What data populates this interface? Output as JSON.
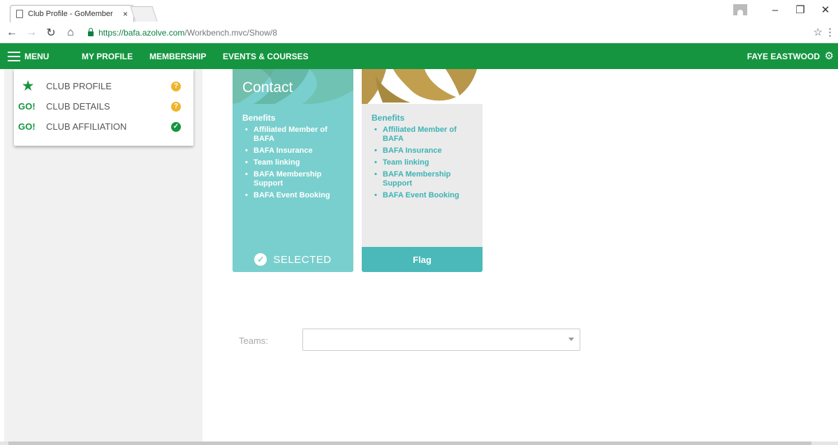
{
  "browser": {
    "tab_title": "Club Profile - GoMember",
    "tab_close": "×",
    "url_host": "https://bafa.azolve.com",
    "url_path": "/Workbench.mvc/Show/8",
    "window_minimize": "–",
    "window_restore": "❐",
    "window_close": "✕"
  },
  "header": {
    "menu_label": "MENU",
    "nav": [
      "MY PROFILE",
      "MEMBERSHIP",
      "EVENTS & COURSES"
    ],
    "user_name": "FAYE EASTWOOD",
    "accent_color": "#159540"
  },
  "steps": [
    {
      "icon": "star-icon",
      "label": "CLUB PROFILE",
      "status": "warning"
    },
    {
      "icon": "go-icon",
      "icon_text": "GO!",
      "label": "CLUB DETAILS",
      "status": "warning"
    },
    {
      "icon": "go-icon",
      "icon_text": "GO!",
      "label": "CLUB AFFILIATION",
      "status": "complete"
    }
  ],
  "plans": [
    {
      "title": "Contact",
      "benefits_heading": "Benefits",
      "benefits": [
        "Affiliated Member of BAFA",
        "BAFA Insurance",
        "Team linking",
        "BAFA Membership Support",
        "BAFA Event Booking"
      ],
      "footer": "SELECTED",
      "selected": true,
      "color": "#79cfcd"
    },
    {
      "title": "",
      "benefits_heading": "Benefits",
      "benefits": [
        "Affiliated Member of BAFA",
        "BAFA Insurance",
        "Team linking",
        "BAFA Membership Support",
        "BAFA Event Booking"
      ],
      "footer": "Flag",
      "selected": false,
      "color": "#4bb9b9"
    }
  ],
  "teams": {
    "label": "Teams:",
    "value": ""
  }
}
